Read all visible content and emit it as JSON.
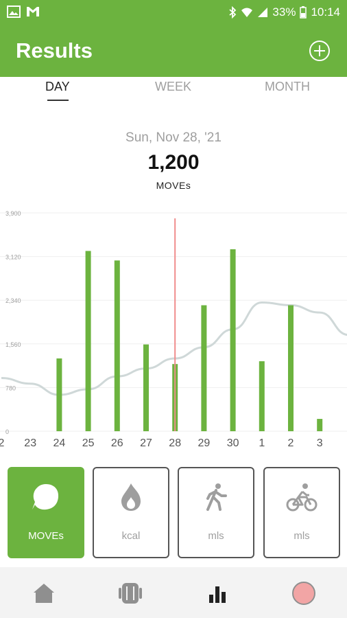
{
  "status_bar": {
    "battery": "33%",
    "time": "10:14"
  },
  "app_bar": {
    "title": "Results"
  },
  "tabs": [
    {
      "label": "DAY",
      "active": true
    },
    {
      "label": "WEEK",
      "active": false
    },
    {
      "label": "MONTH",
      "active": false
    }
  ],
  "summary": {
    "date": "Sun, Nov 28, '21",
    "value": "1,200",
    "unit": "MOVEs"
  },
  "chart_data": {
    "type": "bar",
    "y_ticks": [
      "3,900",
      "3,120",
      "2,340",
      "1,560",
      "780",
      "0"
    ],
    "ylim": [
      0,
      3900
    ],
    "x_labels": [
      "2",
      "23",
      "24",
      "25",
      "26",
      "27",
      "28",
      "29",
      "30",
      "1",
      "2",
      "3"
    ],
    "bars": [
      {
        "x": "24",
        "value": 1300
      },
      {
        "x": "25",
        "value": 3220
      },
      {
        "x": "26",
        "value": 3050
      },
      {
        "x": "27",
        "value": 1550
      },
      {
        "x": "28",
        "value": 1200
      },
      {
        "x": "29",
        "value": 2250
      },
      {
        "x": "30",
        "value": 3250
      },
      {
        "x": "1",
        "value": 1250
      },
      {
        "x": "2",
        "value": 2250
      },
      {
        "x": "3",
        "value": 220
      }
    ],
    "trend_line": [
      {
        "x": "2",
        "value": 950
      },
      {
        "x": "23",
        "value": 850
      },
      {
        "x": "24",
        "value": 650
      },
      {
        "x": "25",
        "value": 750
      },
      {
        "x": "26",
        "value": 980
      },
      {
        "x": "27",
        "value": 1120
      },
      {
        "x": "28",
        "value": 1300
      },
      {
        "x": "29",
        "value": 1500
      },
      {
        "x": "30",
        "value": 1820
      },
      {
        "x": "1",
        "value": 2300
      },
      {
        "x": "2",
        "value": 2250
      },
      {
        "x": "3",
        "value": 2120
      },
      {
        "x": "",
        "value": 1720
      }
    ],
    "selected_x": "28",
    "colors": {
      "bar": "#6cb33f",
      "trend": "#cfd8d8",
      "marker": "#f08c8c",
      "grid": "#efefef"
    }
  },
  "metrics": [
    {
      "label": "MOVEs",
      "icon": "moves-icon",
      "active": true
    },
    {
      "label": "kcal",
      "icon": "flame-icon",
      "active": false
    },
    {
      "label": "mls",
      "icon": "walking-icon",
      "active": false
    },
    {
      "label": "mls",
      "icon": "bicycle-icon",
      "active": false
    }
  ],
  "bottom_nav": [
    {
      "icon": "home-icon"
    },
    {
      "icon": "device-icon"
    },
    {
      "icon": "bar-chart-icon"
    },
    {
      "icon": "record-icon"
    }
  ],
  "colors": {
    "brand": "#6cb33f",
    "nav_bg": "#f3f3f3"
  }
}
